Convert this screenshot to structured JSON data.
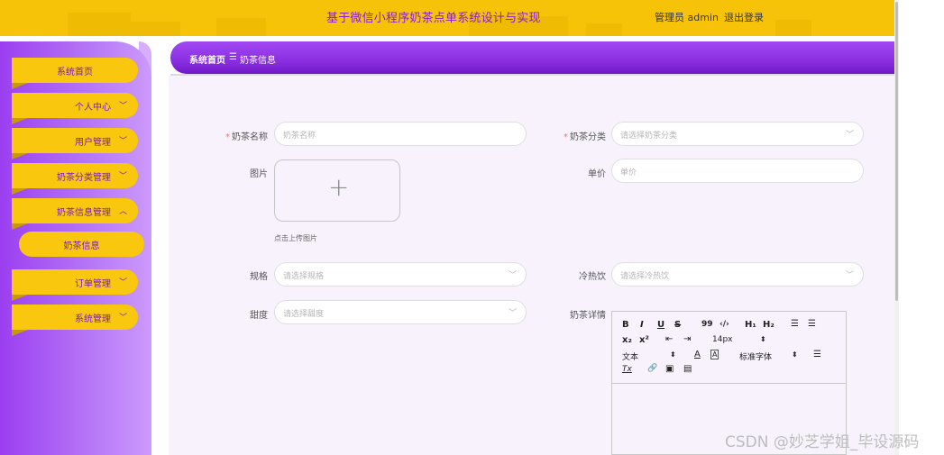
{
  "header": {
    "title": "基于微信小程序奶茶点单系统设计与实现",
    "user_label": "管理员 admin",
    "logout_label": "退出登录"
  },
  "sidebar": {
    "items": [
      {
        "label": "系统首页"
      },
      {
        "label": "个人中心"
      },
      {
        "label": "用户管理"
      },
      {
        "label": "奶茶分类管理"
      },
      {
        "label": "奶茶信息管理"
      },
      {
        "label": "订单管理"
      },
      {
        "label": "系统管理"
      }
    ],
    "submenu": {
      "label": "奶茶信息"
    }
  },
  "breadcrumb": {
    "home": "系统首页",
    "separator": "☰",
    "current": "奶茶信息"
  },
  "form": {
    "name": {
      "label": "奶茶名称",
      "required_mark": "*",
      "placeholder": "奶茶名称"
    },
    "category": {
      "label": "奶茶分类",
      "required_mark": "*",
      "placeholder": "请选择奶茶分类"
    },
    "image": {
      "label": "图片",
      "hint": "点击上传图片"
    },
    "price": {
      "label": "单价",
      "placeholder": "单价"
    },
    "spec": {
      "label": "规格",
      "placeholder": "请选择规格"
    },
    "temperature": {
      "label": "冷热饮",
      "placeholder": "请选择冷热饮"
    },
    "sweetness": {
      "label": "甜度",
      "placeholder": "请选择甜度"
    },
    "detail": {
      "label": "奶茶详情"
    }
  },
  "editor": {
    "bold": "B",
    "italic": "I",
    "underline": "U",
    "strike": "S",
    "quote": "99",
    "code": "‹/›",
    "h1": "H₁",
    "h2": "H₂",
    "ordered_list": "☰",
    "bullet_list": "☰",
    "subscript": "x₂",
    "superscript": "x²",
    "indent": "⇤",
    "outdent": "⇥",
    "font_size": "14px",
    "select_arrow": "⬍",
    "paragraph": "文本",
    "font_color": "A",
    "background_color": "A",
    "font_family": "标准字体",
    "align": "☰",
    "clear_format": "Tx",
    "link": "🔗",
    "image": "▣",
    "video": "▤"
  },
  "watermark": "CSDN @妙芝学姐_毕设源码"
}
